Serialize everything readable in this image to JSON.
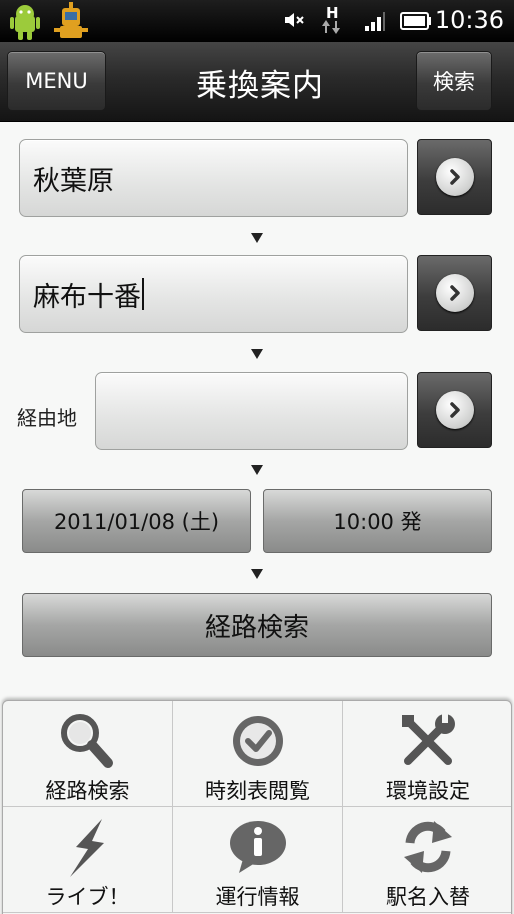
{
  "status_bar": {
    "clock": "10:36",
    "network_type": "H"
  },
  "title_bar": {
    "menu_label": "MENU",
    "title": "乗換案内",
    "search_label": "検索"
  },
  "form": {
    "origin_value": "秋葉原",
    "destination_value": "麻布十番",
    "via_label": "経由地",
    "via_value": "",
    "date_label": "2011/01/08 (土)",
    "time_label": "10:00 発",
    "route_search_label": "経路検索"
  },
  "menu": {
    "items": [
      {
        "label": "経路検索",
        "icon": "magnifier-icon"
      },
      {
        "label": "時刻表閲覧",
        "icon": "clock-check-icon"
      },
      {
        "label": "環境設定",
        "icon": "tools-icon"
      },
      {
        "label": "ライブ！",
        "icon": "lightning-icon"
      },
      {
        "label": "運行情報",
        "icon": "info-icon"
      },
      {
        "label": "駅名入替",
        "icon": "swap-arrows-icon"
      }
    ]
  },
  "colors": {
    "title_bar": "#2a2a2a",
    "background": "#f7f8f7",
    "button_gray": "#a5a6a5"
  }
}
